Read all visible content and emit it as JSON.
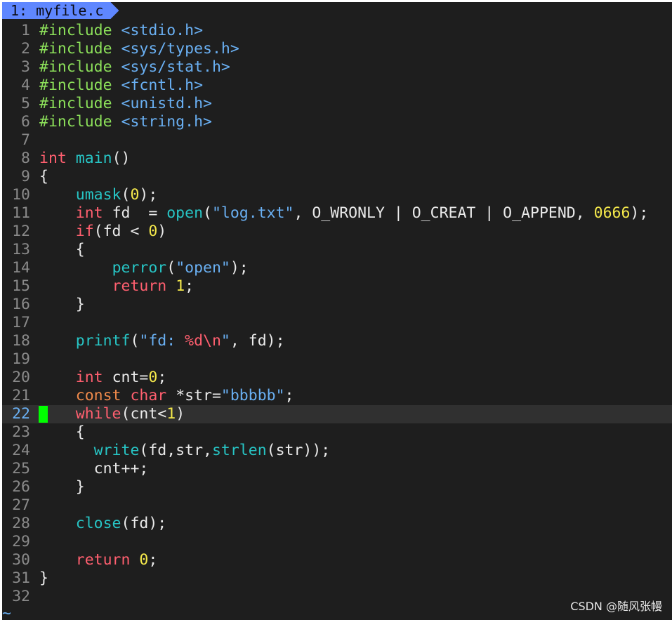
{
  "tab": {
    "label": "1: myfile.c"
  },
  "current_line": 22,
  "lines": [
    {
      "num": "1",
      "tokens": [
        [
          "pp",
          "#include"
        ],
        [
          "plain",
          " "
        ],
        [
          "inc",
          "<stdio.h>"
        ]
      ]
    },
    {
      "num": "2",
      "tokens": [
        [
          "pp",
          "#include"
        ],
        [
          "plain",
          " "
        ],
        [
          "inc",
          "<sys/types.h>"
        ]
      ]
    },
    {
      "num": "3",
      "tokens": [
        [
          "pp",
          "#include"
        ],
        [
          "plain",
          " "
        ],
        [
          "inc",
          "<sys/stat.h>"
        ]
      ]
    },
    {
      "num": "4",
      "tokens": [
        [
          "pp",
          "#include"
        ],
        [
          "plain",
          " "
        ],
        [
          "inc",
          "<fcntl.h>"
        ]
      ]
    },
    {
      "num": "5",
      "tokens": [
        [
          "pp",
          "#include"
        ],
        [
          "plain",
          " "
        ],
        [
          "inc",
          "<unistd.h>"
        ]
      ]
    },
    {
      "num": "6",
      "tokens": [
        [
          "pp",
          "#include"
        ],
        [
          "plain",
          " "
        ],
        [
          "inc",
          "<string.h>"
        ]
      ]
    },
    {
      "num": "7",
      "tokens": []
    },
    {
      "num": "8",
      "tokens": [
        [
          "kw",
          "int"
        ],
        [
          "plain",
          " "
        ],
        [
          "fn",
          "main"
        ],
        [
          "plain",
          "()"
        ]
      ]
    },
    {
      "num": "9",
      "tokens": [
        [
          "plain",
          "{"
        ]
      ]
    },
    {
      "num": "10",
      "tokens": [
        [
          "plain",
          "    "
        ],
        [
          "fn",
          "umask"
        ],
        [
          "plain",
          "("
        ],
        [
          "num",
          "0"
        ],
        [
          "plain",
          ");"
        ]
      ]
    },
    {
      "num": "11",
      "tokens": [
        [
          "plain",
          "    "
        ],
        [
          "kw",
          "int"
        ],
        [
          "plain",
          " fd  = "
        ],
        [
          "fn",
          "open"
        ],
        [
          "plain",
          "("
        ],
        [
          "str",
          "\"log.txt\""
        ],
        [
          "plain",
          ", O_WRONLY | O_CREAT | O_APPEND, "
        ],
        [
          "num",
          "0666"
        ],
        [
          "plain",
          ");"
        ]
      ]
    },
    {
      "num": "12",
      "tokens": [
        [
          "plain",
          "    "
        ],
        [
          "kw",
          "if"
        ],
        [
          "plain",
          "(fd < "
        ],
        [
          "num",
          "0"
        ],
        [
          "plain",
          ")"
        ]
      ]
    },
    {
      "num": "13",
      "tokens": [
        [
          "plain",
          "    {"
        ]
      ]
    },
    {
      "num": "14",
      "tokens": [
        [
          "plain",
          "        "
        ],
        [
          "fn",
          "perror"
        ],
        [
          "plain",
          "("
        ],
        [
          "str",
          "\"open\""
        ],
        [
          "plain",
          ");"
        ]
      ]
    },
    {
      "num": "15",
      "tokens": [
        [
          "plain",
          "        "
        ],
        [
          "kw",
          "return"
        ],
        [
          "plain",
          " "
        ],
        [
          "num",
          "1"
        ],
        [
          "plain",
          ";"
        ]
      ]
    },
    {
      "num": "16",
      "tokens": [
        [
          "plain",
          "    }"
        ]
      ]
    },
    {
      "num": "17",
      "tokens": []
    },
    {
      "num": "18",
      "tokens": [
        [
          "plain",
          "    "
        ],
        [
          "fn",
          "printf"
        ],
        [
          "plain",
          "("
        ],
        [
          "str",
          "\"fd: "
        ],
        [
          "esc",
          "%d\\n"
        ],
        [
          "str",
          "\""
        ],
        [
          "plain",
          ", fd);"
        ]
      ]
    },
    {
      "num": "19",
      "tokens": []
    },
    {
      "num": "20",
      "tokens": [
        [
          "plain",
          "    "
        ],
        [
          "kw",
          "int"
        ],
        [
          "plain",
          " cnt="
        ],
        [
          "num",
          "0"
        ],
        [
          "plain",
          ";"
        ]
      ]
    },
    {
      "num": "21",
      "tokens": [
        [
          "plain",
          "    "
        ],
        [
          "const",
          "const"
        ],
        [
          "plain",
          " "
        ],
        [
          "kw",
          "char"
        ],
        [
          "plain",
          " *str="
        ],
        [
          "str",
          "\"bbbbb\""
        ],
        [
          "plain",
          ";"
        ]
      ]
    },
    {
      "num": "22",
      "tokens": [
        [
          "plain",
          "    "
        ],
        [
          "kw",
          "while"
        ],
        [
          "plain",
          "(cnt<"
        ],
        [
          "num",
          "1"
        ],
        [
          "plain",
          ")"
        ]
      ]
    },
    {
      "num": "23",
      "tokens": [
        [
          "plain",
          "    {"
        ]
      ]
    },
    {
      "num": "24",
      "tokens": [
        [
          "plain",
          "      "
        ],
        [
          "fn",
          "write"
        ],
        [
          "plain",
          "(fd,str,"
        ],
        [
          "fn",
          "strlen"
        ],
        [
          "plain",
          "(str));"
        ]
      ]
    },
    {
      "num": "25",
      "tokens": [
        [
          "plain",
          "      cnt++;"
        ]
      ]
    },
    {
      "num": "26",
      "tokens": [
        [
          "plain",
          "    }"
        ]
      ]
    },
    {
      "num": "27",
      "tokens": []
    },
    {
      "num": "28",
      "tokens": [
        [
          "plain",
          "    "
        ],
        [
          "fn",
          "close"
        ],
        [
          "plain",
          "(fd);"
        ]
      ]
    },
    {
      "num": "29",
      "tokens": []
    },
    {
      "num": "30",
      "tokens": [
        [
          "plain",
          "    "
        ],
        [
          "kw",
          "return"
        ],
        [
          "plain",
          " "
        ],
        [
          "num",
          "0"
        ],
        [
          "plain",
          ";"
        ]
      ]
    },
    {
      "num": "31",
      "tokens": [
        [
          "plain",
          "}"
        ]
      ]
    },
    {
      "num": "32",
      "tokens": []
    }
  ],
  "tilde": "~",
  "watermark": "CSDN @随风张幔",
  "colors": {
    "background": "#1e1e1e",
    "tab": "#5f87ff",
    "cursor": "#00ff00",
    "current_line_bg": "#303030",
    "preprocessor": "#8ce05a",
    "string": "#6ab0f3",
    "keyword": "#ff5f6f",
    "function": "#27c5c5",
    "number": "#f5e94b",
    "storage_class": "#f08a4b"
  }
}
